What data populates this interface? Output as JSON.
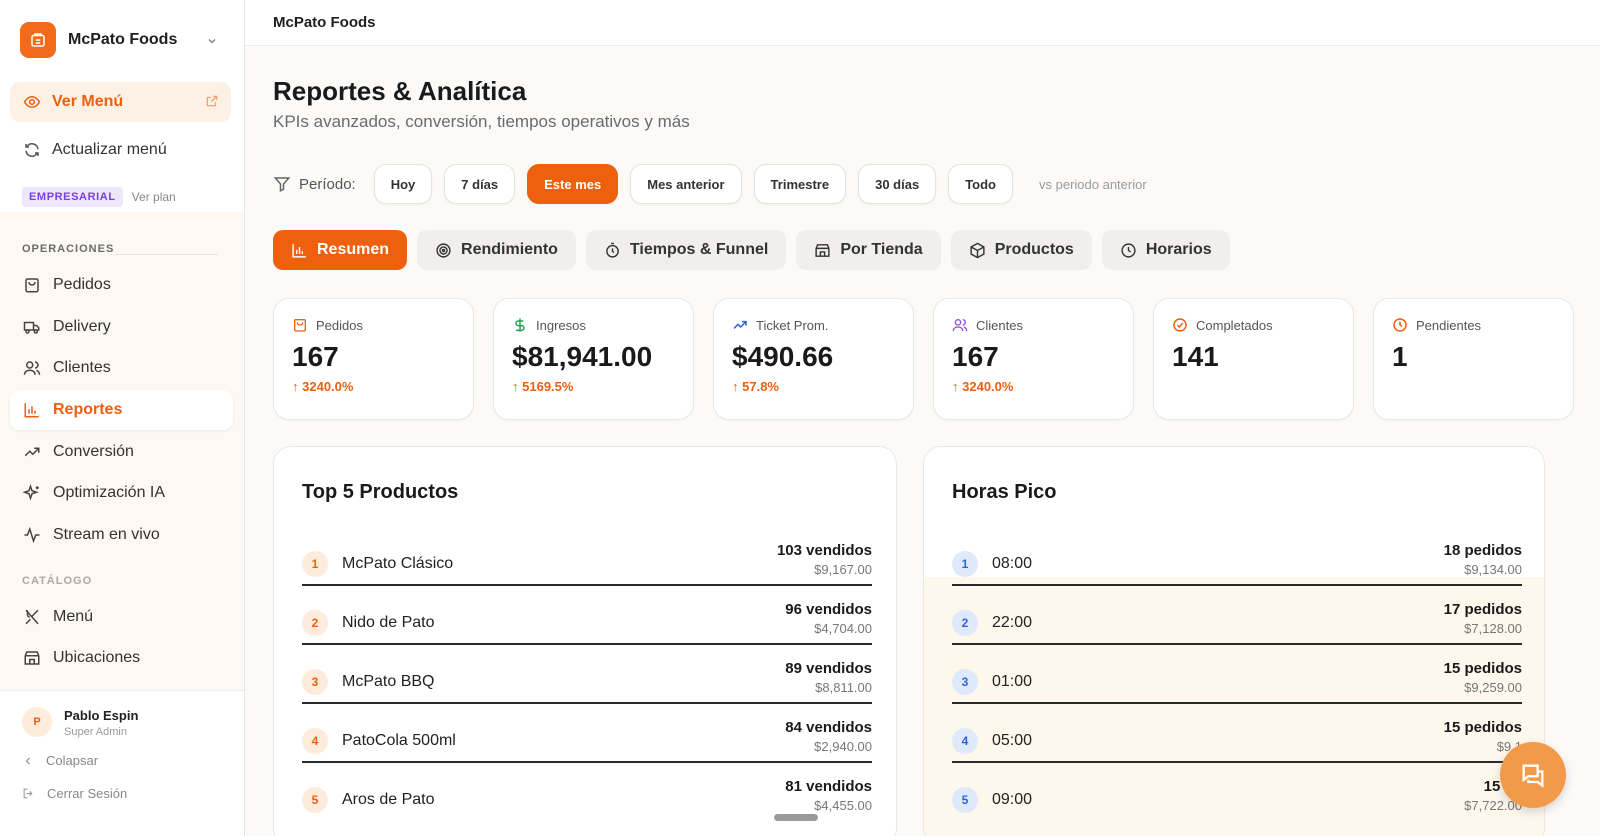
{
  "sidebar": {
    "brand": "McPato Foods",
    "view_menu": "Ver Menú",
    "update_menu": "Actualizar menú",
    "plan_badge": "EMPRESARIAL",
    "plan_link": "Ver plan",
    "section_operations": "OPERACIONES",
    "section_catalog": "CATÁLOGO",
    "nav": {
      "orders": "Pedidos",
      "delivery": "Delivery",
      "clients": "Clientes",
      "reports": "Reportes",
      "conversion": "Conversión",
      "ai": "Optimización IA",
      "stream": "Stream en vivo",
      "menu": "Menú",
      "locations": "Ubicaciones"
    },
    "user": {
      "initial": "P",
      "name": "Pablo Espin",
      "role": "Super Admin"
    },
    "collapse": "Colapsar",
    "logout": "Cerrar Sesión"
  },
  "header": {
    "title": "McPato Foods"
  },
  "page": {
    "title": "Reportes & Analítica",
    "subtitle": "KPIs avanzados, conversión, tiempos operativos y más"
  },
  "period": {
    "label": "Período:",
    "options": [
      "Hoy",
      "7 días",
      "Este mes",
      "Mes anterior",
      "Trimestre",
      "30 días",
      "Todo"
    ],
    "selected": "Este mes",
    "compare_text": "vs periodo anterior"
  },
  "tabs": [
    "Resumen",
    "Rendimiento",
    "Tiempos & Funnel",
    "Por Tienda",
    "Productos",
    "Horarios"
  ],
  "active_tab": "Resumen",
  "kpis": [
    {
      "label": "Pedidos",
      "value": "167",
      "delta": "3240.0%",
      "icon": "bag-icon",
      "color": "#ee5f0e"
    },
    {
      "label": "Ingresos",
      "value": "$81,941.00",
      "delta": "5169.5%",
      "icon": "dollar-icon",
      "color": "#22a050"
    },
    {
      "label": "Ticket Prom.",
      "value": "$490.66",
      "delta": "57.8%",
      "icon": "trend-up-icon",
      "color": "#2f63d8"
    },
    {
      "label": "Clientes",
      "value": "167",
      "delta": "3240.0%",
      "icon": "users-icon",
      "color": "#8b4fe0"
    },
    {
      "label": "Completados",
      "value": "141",
      "delta": "",
      "icon": "check-circle-icon",
      "color": "#ee5f0e"
    },
    {
      "label": "Pendientes",
      "value": "1",
      "delta": "",
      "icon": "clock-icon",
      "color": "#ee5f0e"
    }
  ],
  "top_products": {
    "title": "Top 5 Productos",
    "items": [
      {
        "rank": "1",
        "name": "McPato Clásico",
        "sold": "103 vendidos",
        "revenue": "$9,167.00"
      },
      {
        "rank": "2",
        "name": "Nido de Pato",
        "sold": "96 vendidos",
        "revenue": "$4,704.00"
      },
      {
        "rank": "3",
        "name": "McPato BBQ",
        "sold": "89 vendidos",
        "revenue": "$8,811.00"
      },
      {
        "rank": "4",
        "name": "PatoCola 500ml",
        "sold": "84 vendidos",
        "revenue": "$2,940.00"
      },
      {
        "rank": "5",
        "name": "Aros de Pato",
        "sold": "81 vendidos",
        "revenue": "$4,455.00"
      }
    ]
  },
  "peak_hours": {
    "title": "Horas Pico",
    "items": [
      {
        "rank": "1",
        "hour": "08:00",
        "orders": "18 pedidos",
        "revenue": "$9,134.00"
      },
      {
        "rank": "2",
        "hour": "22:00",
        "orders": "17 pedidos",
        "revenue": "$7,128.00"
      },
      {
        "rank": "3",
        "hour": "01:00",
        "orders": "15 pedidos",
        "revenue": "$9,259.00"
      },
      {
        "rank": "4",
        "hour": "05:00",
        "orders": "15 pedidos",
        "revenue": "$9,1"
      },
      {
        "rank": "5",
        "hour": "09:00",
        "orders": "15 pe",
        "revenue": "$7,722.00"
      }
    ]
  },
  "colors": {
    "accent": "#ee5f0e",
    "rank_blue": "#2f63d8"
  }
}
